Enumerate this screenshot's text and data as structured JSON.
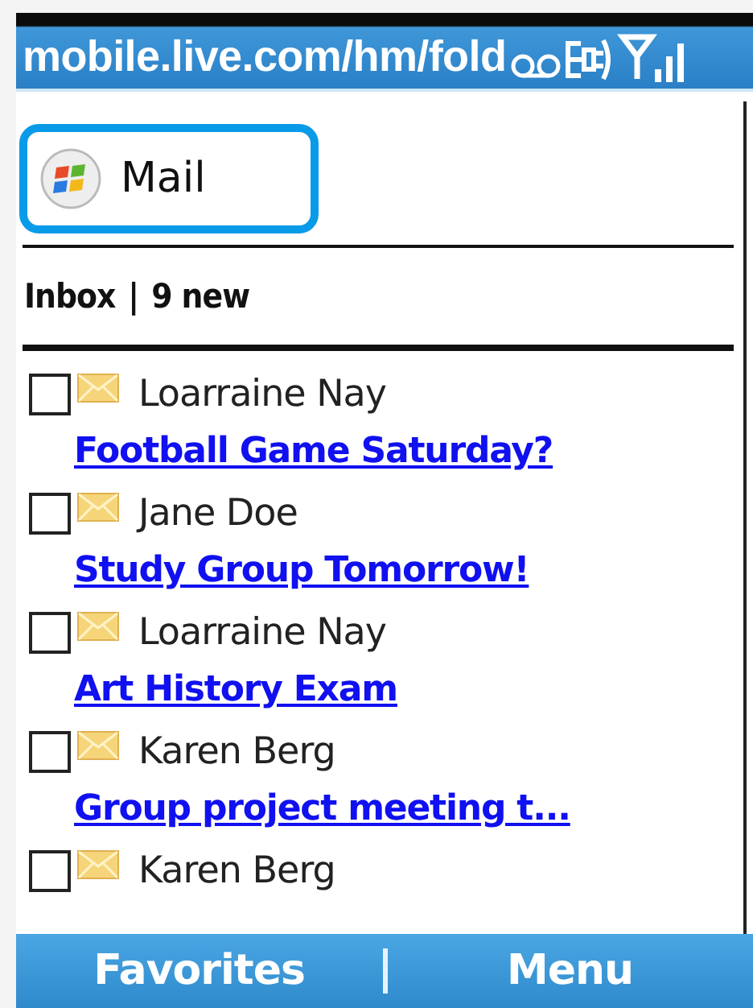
{
  "title_bar": {
    "url": "mobile.live.com/hm/fold"
  },
  "app": {
    "title": "Mail",
    "selected": true
  },
  "folder": {
    "name": "Inbox",
    "separator": "|",
    "count": "9 new"
  },
  "messages": [
    {
      "sender": "Loarraine Nay",
      "subject": "Football Game Saturday?",
      "checked": false
    },
    {
      "sender": "Jane Doe",
      "subject": "Study Group Tomorrow!",
      "checked": false
    },
    {
      "sender": "Loarraine Nay",
      "subject": "Art History Exam",
      "checked": false
    },
    {
      "sender": "Karen Berg",
      "subject": "Group project meeting t...",
      "checked": false
    },
    {
      "sender": "Karen Berg",
      "checked": false
    }
  ],
  "softkeys": {
    "left": "Favorites",
    "right": "Menu"
  }
}
